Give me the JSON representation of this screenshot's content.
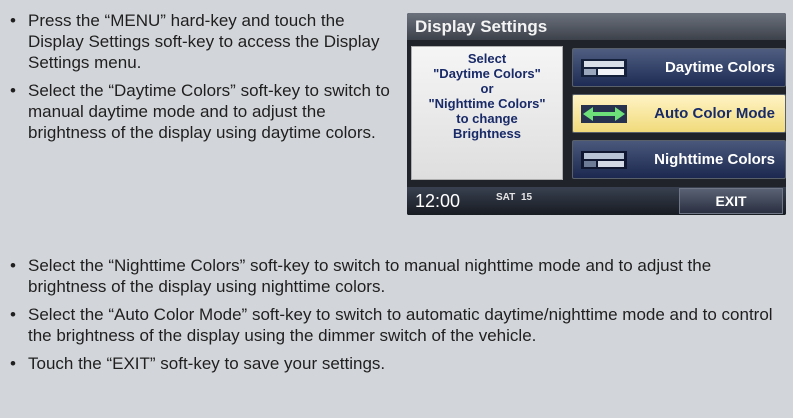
{
  "bullet_char": "•",
  "instructions_top": [
    "Press the “MENU” hard-key and touch the Display Settings soft-key to access the Display Settings menu.",
    "Select the “Daytime Colors” soft-key to switch to manual daytime mode and to adjust the brightness of the display using daytime colors."
  ],
  "instructions_bottom": [
    "Select the “Nighttime Colors” soft-key to switch to manual nighttime mode and to adjust the brightness of the display using nighttime colors.",
    "Select the “Auto Color Mode” soft-key to switch to automatic daytime/nighttime mode and to control the brightness of the display using the dimmer switch of the vehicle.",
    "Touch the “EXIT” soft-key to save your settings."
  ],
  "screen": {
    "title": "Display Settings",
    "instruction_lines": [
      "Select",
      "\"Daytime Colors\"",
      "or",
      "\"Nighttime Colors\"",
      "to change",
      "Brightness"
    ],
    "softkeys": {
      "daytime": {
        "label": "Daytime Colors",
        "icon": "daytime-display-icon"
      },
      "auto": {
        "label": "Auto Color Mode",
        "icon": "auto-color-arrows-icon"
      },
      "nighttime": {
        "label": "Nighttime Colors",
        "icon": "nighttime-display-icon"
      }
    },
    "status_bar": {
      "time": "12:00",
      "sat_label": "SAT",
      "sat_channel": "15",
      "exit_label": "EXIT"
    }
  },
  "colors": {
    "page_background": "#d2d5d9",
    "screen_background": "#20232a",
    "highlight_key": "#f1db7c",
    "key_text_dark": "#182b68"
  }
}
